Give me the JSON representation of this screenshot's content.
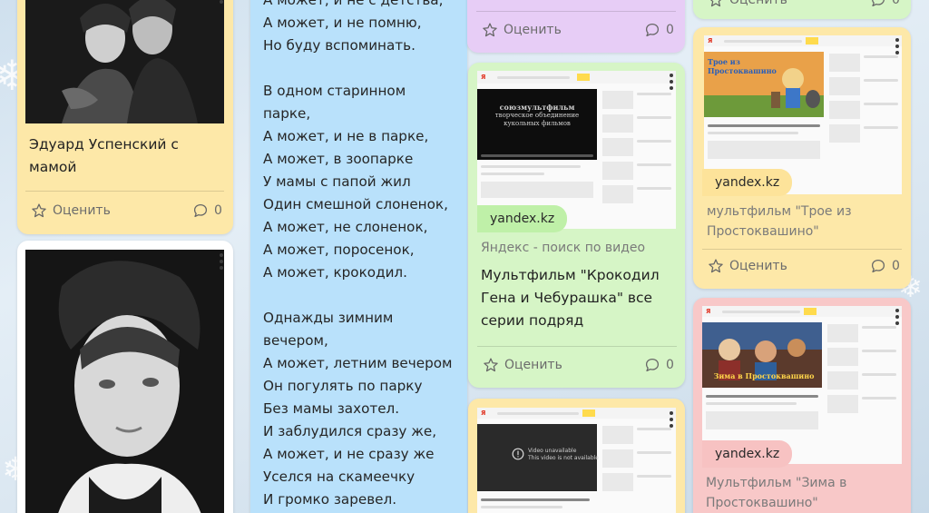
{
  "cards": {
    "uspensky_mom": {
      "caption": "Эдуард Успенский с мамой",
      "rate_label": "Оценить",
      "comments": "0"
    },
    "poem": {
      "lines": [
        "А может, и не с детства,",
        "А может, и не помню,",
        "Но буду вспоминать.",
        "",
        "В одном старинном",
        "парке,",
        "А может, и не в парке,",
        "А может, в зоопарке",
        "У мамы с папой жил",
        "Один смешной слоненок,",
        "А может, не слоненок,",
        "А может, поросенок,",
        "А может, крокодил.",
        "",
        "Однажды зимним",
        "вечером,",
        "А может, летним вечером",
        "Он погулять по парку",
        "Без мамы захотел.",
        "И заблудился сразу же,",
        "А может, и не сразу же",
        "Уселся на скамеечку",
        "И громко заревел."
      ]
    },
    "purple_top": {
      "rate_label": "Оценить",
      "comments": "0"
    },
    "green_top": {
      "rate_label": "Оценить",
      "comments": "0"
    },
    "gena": {
      "source": "yandex.kz",
      "subtitle": "Яндекс - поиск по видео",
      "caption": "Мультфильм \"Крокодил Гена и Чебурашка\" все серии подряд",
      "rate_label": "Оценить",
      "comments": "0",
      "thumb_text": [
        "союзмультфильм",
        "творческое объединение кукольных фильмов"
      ]
    },
    "troe": {
      "source": "yandex.kz",
      "caption": "мультфильм \"Трое из Простоквашино\"",
      "rate_label": "Оценить",
      "comments": "0",
      "thumb_title": "Трое из Простоквашино"
    },
    "zima": {
      "source": "yandex.kz",
      "caption": "Мультфильм \"Зима в Простоквашино\"",
      "thumb_title": "Зима в Простоквашино"
    },
    "unavailable": {
      "thumb_text": [
        "Video unavailable",
        "This video is not available"
      ]
    }
  },
  "colors": {
    "yellow": "#fde8a8",
    "blue": "#b9e1fb",
    "purple": "#e7cdf6",
    "green": "#d6f5c6",
    "pink": "#f8c8c8",
    "pill_green": "#bff0a8",
    "pill_yellow": "#fde39a",
    "pill_pink": "#f7c2c2"
  },
  "icons": [
    "star-icon",
    "comment-icon",
    "kebab-menu-icon",
    "snowflake-icon",
    "play-icon"
  ]
}
